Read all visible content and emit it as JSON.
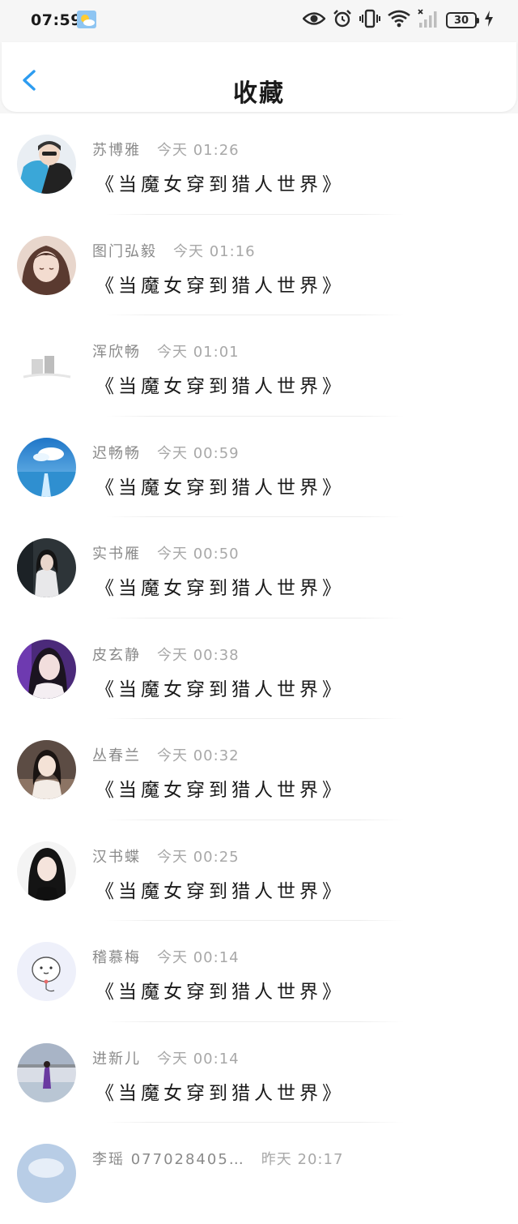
{
  "status_bar": {
    "time": "07:59",
    "battery_level": "30"
  },
  "header": {
    "title": "收藏"
  },
  "items": [
    {
      "name": "苏博雅",
      "time": "今天 01:26",
      "book": "《当魔女穿到猎人世界》"
    },
    {
      "name": "图门弘毅",
      "time": "今天 01:16",
      "book": "《当魔女穿到猎人世界》"
    },
    {
      "name": "浑欣畅",
      "time": "今天 01:01",
      "book": "《当魔女穿到猎人世界》"
    },
    {
      "name": "迟畅畅",
      "time": "今天 00:59",
      "book": "《当魔女穿到猎人世界》"
    },
    {
      "name": "实书雁",
      "time": "今天 00:50",
      "book": "《当魔女穿到猎人世界》"
    },
    {
      "name": "皮玄静",
      "time": "今天 00:38",
      "book": "《当魔女穿到猎人世界》"
    },
    {
      "name": "丛春兰",
      "time": "今天 00:32",
      "book": "《当魔女穿到猎人世界》"
    },
    {
      "name": "汉书蝶",
      "time": "今天 00:25",
      "book": "《当魔女穿到猎人世界》"
    },
    {
      "name": "稽慕梅",
      "time": "今天 00:14",
      "book": "《当魔女穿到猎人世界》"
    },
    {
      "name": "进新儿",
      "time": "今天 00:14",
      "book": "《当魔女穿到猎人世界》"
    },
    {
      "name": "李瑶 077028405…",
      "time": "昨天 20:17",
      "book": ""
    }
  ],
  "colors": {
    "accent": "#2d9cf0",
    "text_primary": "#1a1a1a",
    "text_secondary": "#8a8a8a"
  }
}
